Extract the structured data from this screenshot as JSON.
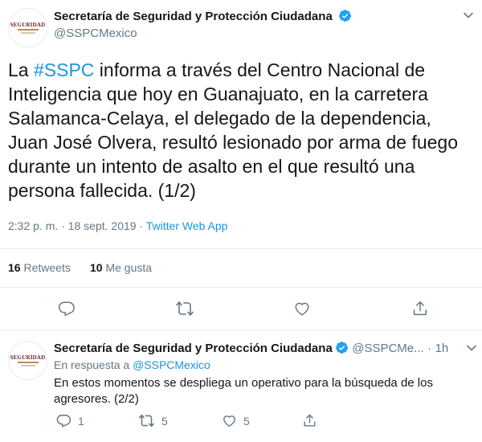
{
  "main_tweet": {
    "author_name": "Secretaría de Seguridad y Protección Ciudadana",
    "author_handle": "@SSPCMexico",
    "avatar_text": "SEGURIDAD",
    "text_prefix": "La ",
    "hashtag": "#SSPC",
    "text_body": " informa a través del Centro Nacional de Inteligencia que hoy en Guanajuato, en la carretera Salamanca-Celaya, el delegado de la dependencia, Juan José Olvera, resultó lesionado por arma de fuego durante un intento de asalto en el que resultó una persona fallecida. (1/2)",
    "time": "2:32 p. m.",
    "separator": "·",
    "date": "18 sept. 2019",
    "source": "Twitter Web App",
    "retweets_count": "16",
    "retweets_label": "Retweets",
    "likes_count": "10",
    "likes_label": "Me gusta"
  },
  "reply_tweet": {
    "author_name": "Secretaría de Seguridad y Protección Ciudadana",
    "author_handle": "@SSPCMe...",
    "separator": "·",
    "age": "1h",
    "avatar_text": "SEGURIDAD",
    "in_reply_prefix": "En respuesta a",
    "in_reply_handle": "@SSPCMexico",
    "text": "En estos momentos se despliega un operativo para la búsqueda de los agresores. (2/2)",
    "replies": "1",
    "retweets": "5",
    "likes": "5"
  },
  "colors": {
    "link": "#1b95e0",
    "verified": "#1da1f2",
    "muted": "#657786",
    "divider": "#e6ecf0"
  }
}
